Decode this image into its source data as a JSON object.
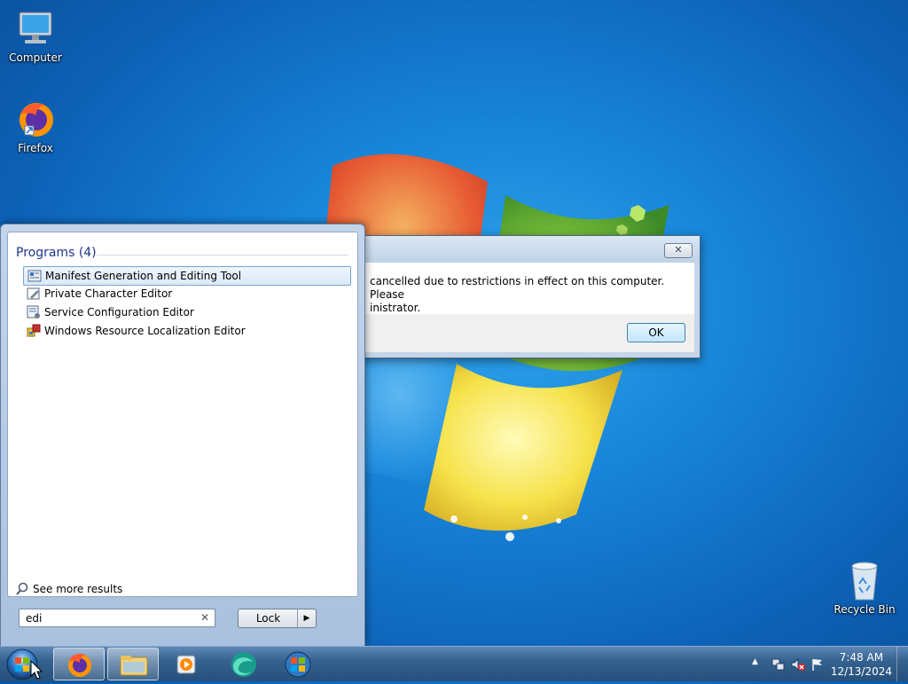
{
  "desktop": {
    "icons": [
      {
        "label": "Computer",
        "icon": "computer-icon"
      },
      {
        "label": "Firefox",
        "icon": "firefox-icon"
      },
      {
        "label": "Recycle Bin",
        "icon": "recycle-bin-icon"
      }
    ]
  },
  "dialog": {
    "message_line1": "cancelled due to restrictions in effect on this computer. Please",
    "message_line2": "inistrator.",
    "close_label": "✕",
    "ok_label": "OK"
  },
  "start_menu": {
    "heading": "Programs (4)",
    "results": [
      {
        "label": "Manifest Generation and Editing Tool",
        "icon": "manifest-tool-icon",
        "selected": true
      },
      {
        "label": "Private Character Editor",
        "icon": "character-editor-icon",
        "selected": false
      },
      {
        "label": "Service Configuration Editor",
        "icon": "service-config-icon",
        "selected": false
      },
      {
        "label": "Windows Resource Localization Editor",
        "icon": "localization-editor-icon",
        "selected": false
      }
    ],
    "see_more": "See more results",
    "search_value": "edi",
    "lock_label": "Lock"
  },
  "taskbar": {
    "items": [
      {
        "name": "firefox",
        "icon": "firefox-icon",
        "active": true
      },
      {
        "name": "windows-explorer",
        "icon": "folder-icon",
        "active": true
      },
      {
        "name": "media-player",
        "icon": "media-player-icon",
        "active": false
      },
      {
        "name": "edge-app",
        "icon": "edge-icon",
        "active": false
      },
      {
        "name": "windows-app",
        "icon": "windows-logo-icon",
        "active": false
      }
    ],
    "clock_time": "7:48 AM",
    "clock_date": "12/13/2024"
  },
  "colors": {
    "desktop_blue": "#1784d8",
    "heading_blue": "#1e3287",
    "taskbar": "#35628f"
  }
}
